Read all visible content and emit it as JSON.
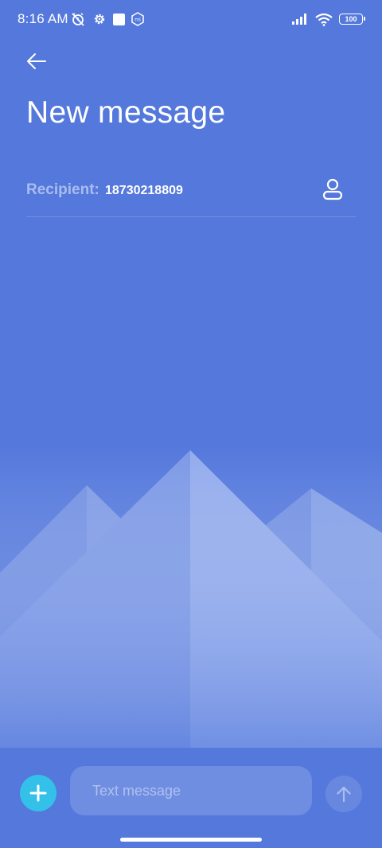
{
  "status_bar": {
    "time": "8:16 AM",
    "battery_level": "100",
    "left_icons": [
      "alarm-off-icon",
      "settings-gear-icon",
      "square-notification-icon",
      "mi-icon"
    ],
    "right_icons": [
      "signal-icon",
      "wifi-icon",
      "battery-icon"
    ]
  },
  "header": {
    "back_icon": "arrow-left-icon",
    "title": "New message"
  },
  "recipient": {
    "label": "Recipient:",
    "value": "18730218809",
    "contact_icon": "person-icon"
  },
  "composer": {
    "add_icon": "plus-icon",
    "placeholder": "Text message",
    "value": "",
    "send_icon": "arrow-up-icon"
  },
  "colors": {
    "background": "#5478dc",
    "add_button": "#33c1ea",
    "text": "#ffffff"
  }
}
